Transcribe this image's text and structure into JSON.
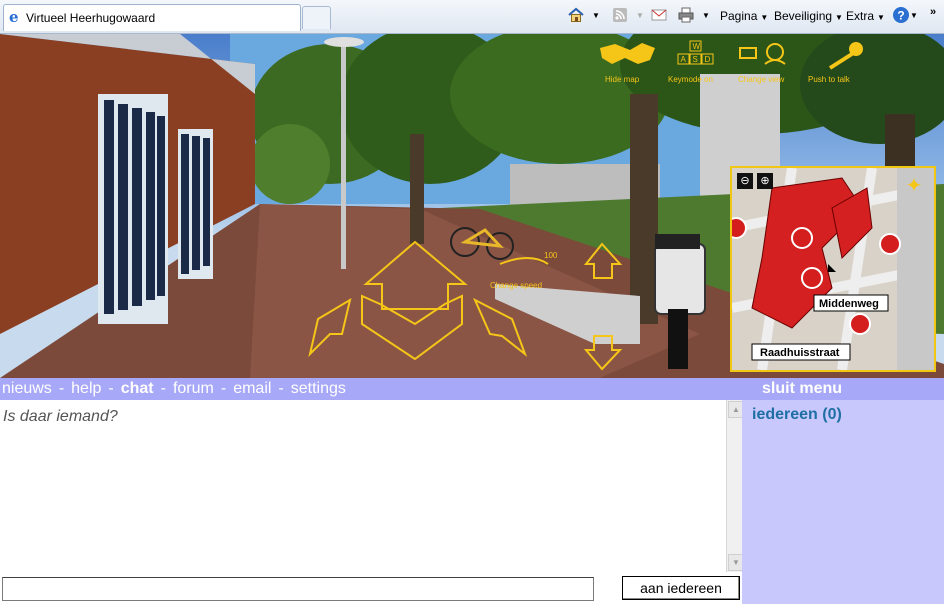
{
  "browser": {
    "tab_title": "Virtueel Heerhugowaard",
    "commands": [
      "Pagina",
      "Beveiliging",
      "Extra"
    ]
  },
  "hud": {
    "hide_map": "Hide map",
    "keymode": "Keymode on",
    "change_view": "Change view",
    "push_to_talk": "Push to talk",
    "change_speed": "Change speed",
    "speed_value": "100",
    "keys": [
      "W",
      "A",
      "S",
      "D"
    ]
  },
  "minimap": {
    "labels": [
      "Middenweg",
      "Raadhuisstraat"
    ]
  },
  "menu": {
    "items": [
      "nieuws",
      "help",
      "chat",
      "forum",
      "email",
      "settings"
    ],
    "separator": "-",
    "active": "chat",
    "close": "sluit menu"
  },
  "chat": {
    "message": "Is daar iemand?",
    "input_value": "",
    "send_button": "aan iedereen",
    "recipients": "iedereen (0)"
  },
  "colors": {
    "hud_yellow": "#f5c518",
    "menu_bg": "#a8a8f8",
    "side_bg": "#c8c8fc",
    "recipient_blue": "#1f6fa5"
  }
}
